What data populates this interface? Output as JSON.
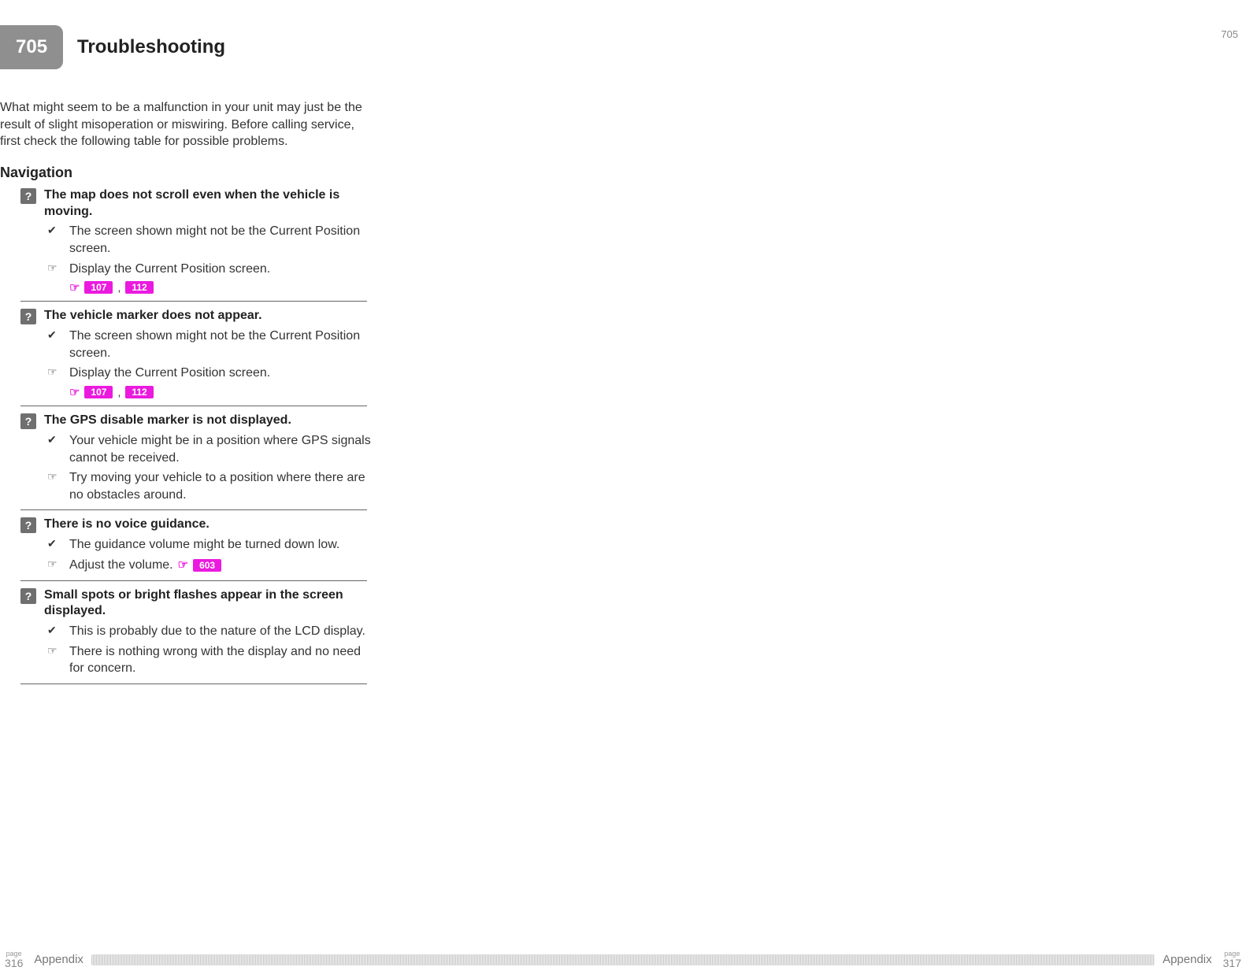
{
  "header": {
    "top_right_number": "705",
    "tab_number": "705",
    "title": "Troubleshooting"
  },
  "intro": "What might seem to be a malfunction in your unit may just be the result of slight misoperation or miswiring. Before calling service, first check the following table for possible problems.",
  "section": "Navigation",
  "marks": {
    "question": "?",
    "check": "✔",
    "pointer": "☞",
    "see": "☞"
  },
  "items": [
    {
      "q": "The map does not scroll even when the vehicle is moving.",
      "check": "The screen shown might not be the Current Position screen.",
      "action": "Display the Current Position screen.",
      "refs": [
        "107",
        "112"
      ]
    },
    {
      "q": "The vehicle marker does not appear.",
      "check": "The screen shown might not be the Current Position screen.",
      "action": "Display the Current Position screen.",
      "refs": [
        "107",
        "112"
      ]
    },
    {
      "q": "The GPS disable marker is not displayed.",
      "check": "Your vehicle might be in a position where GPS signals cannot be received.",
      "action": "Try moving your vehicle to a position where there are no obstacles around.",
      "refs": []
    },
    {
      "q": "There is no voice guidance.",
      "check": "The guidance volume might be turned down low.",
      "action": "Adjust the volume.",
      "refs_inline": [
        "603"
      ]
    },
    {
      "q": "Small spots or bright flashes appear in the screen displayed.",
      "check": "This is probably due to the nature of the LCD display.",
      "action": "There is nothing wrong with the display and no need for concern.",
      "refs": []
    }
  ],
  "footer": {
    "left_page_label": "page",
    "left_page_num": "316",
    "left_section": "Appendix",
    "right_section": "Appendix",
    "right_page_label": "page",
    "right_page_num": "317"
  }
}
